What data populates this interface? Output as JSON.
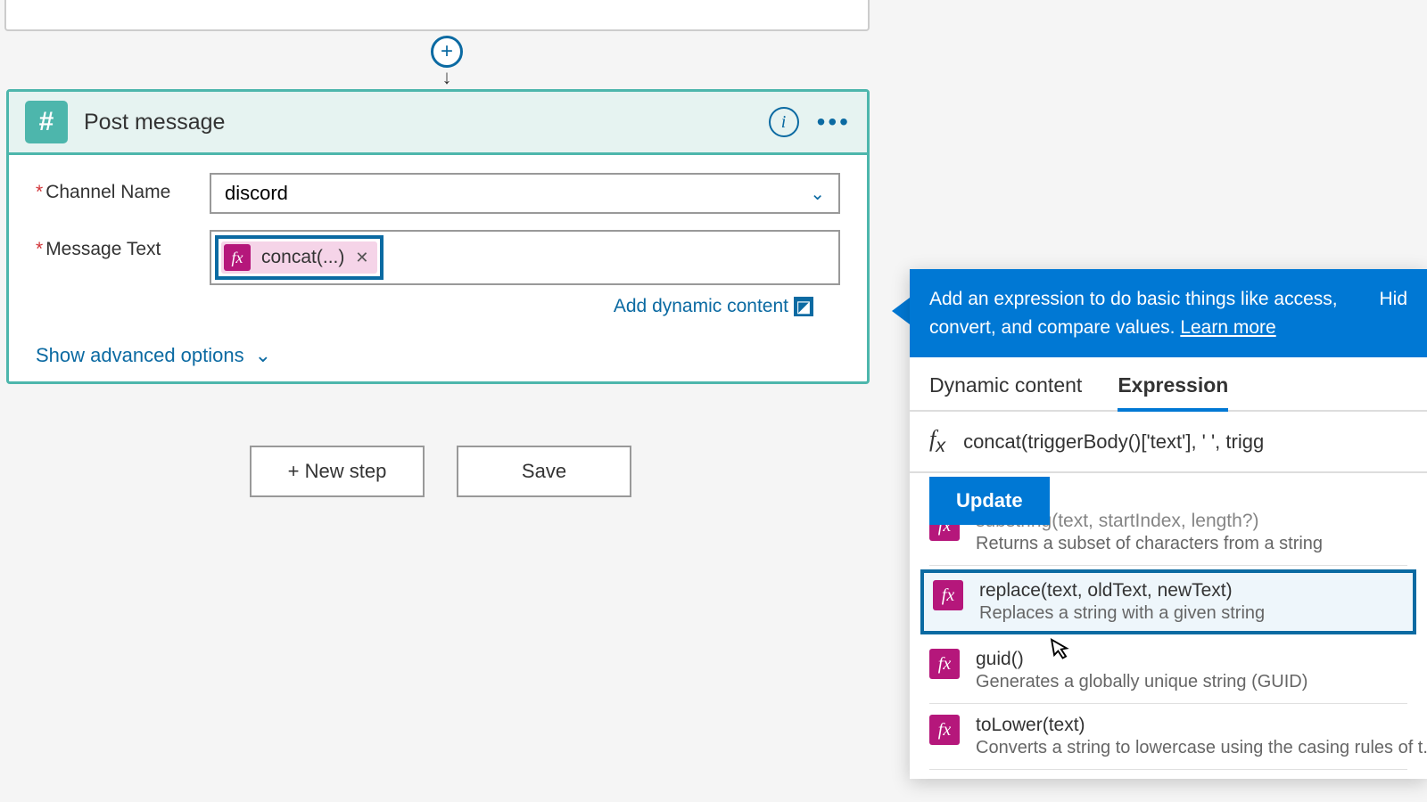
{
  "action": {
    "title": "Post message",
    "fields": {
      "channel_label": "Channel Name",
      "channel_value": "discord",
      "message_label": "Message Text",
      "token_label": "concat(...)"
    },
    "add_dynamic": "Add dynamic content",
    "advanced": "Show advanced options"
  },
  "buttons": {
    "new_step": "+ New step",
    "save": "Save"
  },
  "panel": {
    "intro": "Add an expression to do basic things like access, convert, and compare values. ",
    "learn_more": "Learn more",
    "hide": "Hid",
    "tabs": {
      "dynamic": "Dynamic content",
      "expression": "Expression"
    },
    "expression_value": "concat(triggerBody()['text'], ' ', trigg",
    "update": "Update",
    "functions": [
      {
        "name": "substring(text, startIndex, length?)",
        "desc": "Returns a subset of characters from a string"
      },
      {
        "name": "replace(text, oldText, newText)",
        "desc": "Replaces a string with a given string"
      },
      {
        "name": "guid()",
        "desc": "Generates a globally unique string (GUID)"
      },
      {
        "name": "toLower(text)",
        "desc": "Converts a string to lowercase using the casing rules of t..."
      }
    ]
  }
}
